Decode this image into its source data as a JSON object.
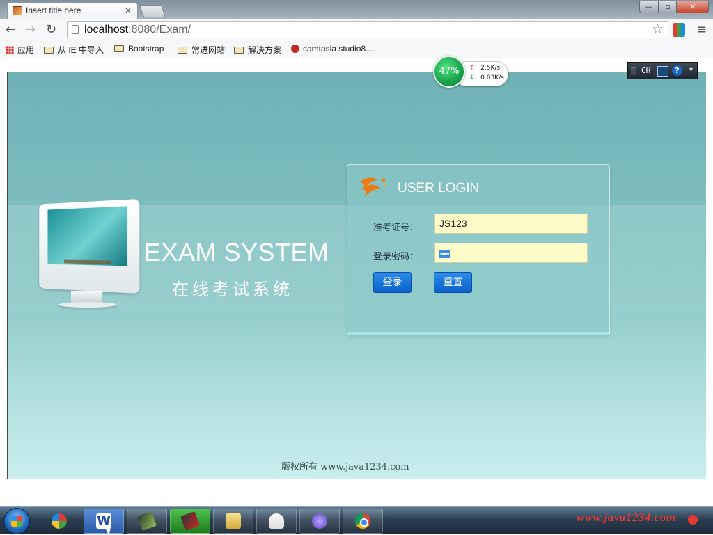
{
  "browser": {
    "tab_title": "Insert title here",
    "tab_close": "×",
    "url_host": "localhost",
    "url_rest": ":8080/Exam/",
    "bookmarks": [
      "应用",
      "从 IE 中导入",
      "Bootstrap",
      "常进网站",
      "解决方案",
      "camtasia studio8...."
    ]
  },
  "speed_widget": {
    "percent": "47%",
    "upload": "2.5K/s",
    "download": "0.03K/s"
  },
  "ime": {
    "mode": "CH",
    "help": "?"
  },
  "page": {
    "exam_title": "EXAM SYSTEM",
    "exam_subtitle": "在线考试系统",
    "login": {
      "heading": "USER LOGIN",
      "id_label": "准考证号：",
      "id_value": "JS123",
      "pw_label": "登录密码：",
      "pw_mask": "•••••",
      "login_button": "登录",
      "reset_button": "重置"
    },
    "footer": "版权所有 www.java1234.com"
  },
  "taskbar": {
    "watermark": "www.java1234.com",
    "task_word_letter": "W"
  },
  "colors": {
    "button_blue": "#0b5fc9",
    "input_yellow": "#fffbc9",
    "stage_teal": "#7cbcbd"
  }
}
